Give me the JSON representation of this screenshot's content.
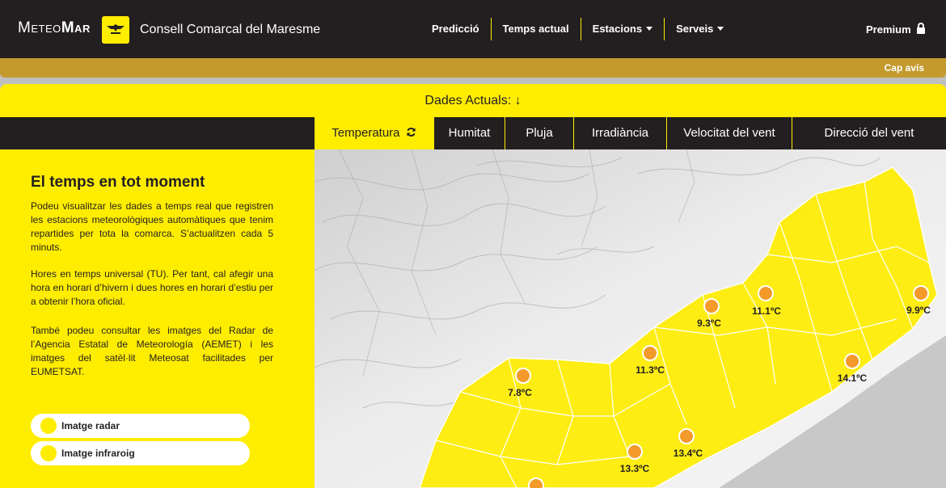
{
  "brand": {
    "part1": "Meteo",
    "part2": "Mar"
  },
  "council": "Consell Comarcal del Maresme",
  "nav": [
    {
      "label": "Predicció",
      "dropdown": false
    },
    {
      "label": "Temps actual",
      "dropdown": false
    },
    {
      "label": "Estacions",
      "dropdown": true
    },
    {
      "label": "Serveis",
      "dropdown": true
    }
  ],
  "premium": "Premium",
  "notice": "Cap avís",
  "dades": "Dades Actuals: ↓",
  "tabs": [
    {
      "label": "Temperatura",
      "active": true
    },
    {
      "label": "Humitat",
      "active": false
    },
    {
      "label": "Pluja",
      "active": false
    },
    {
      "label": "Irradiància",
      "active": false
    },
    {
      "label": "Velocitat del vent",
      "active": false
    },
    {
      "label": "Direcció del vent",
      "active": false
    }
  ],
  "side": {
    "title": "El temps en tot moment",
    "p1": "Podeu visualitzar les dades a temps real que registren les estacions meteorològiques automàtiques que tenim repartides per tota la comarca. S’actualitzen cada 5 minuts.",
    "p2": "Hores en temps universal (TU). Per tant, cal afegir una hora en horari d’hivern i dues hores en horari d’estiu per a obtenir l’hora oficial.",
    "p3": "També podeu consultar les imatges del Radar de l’Agencia Estatal de Meteorología (AEMET) i les imatges del satèl·lit Meteosat facilitades per EUMETSAT.",
    "radar": "Imatge radar",
    "infrared": "Imatge infraroig"
  },
  "stations": [
    "7.8ºC",
    "11.3ºC",
    "9.3ºC",
    "11.1ºC",
    "9.9ºC",
    "14.1ºC",
    "13.4ºC",
    "13.3ºC"
  ],
  "colors": {
    "accent": "#ffed00",
    "dark": "#231f20",
    "notice": "#c49a2e",
    "station": "#f39a2b"
  }
}
